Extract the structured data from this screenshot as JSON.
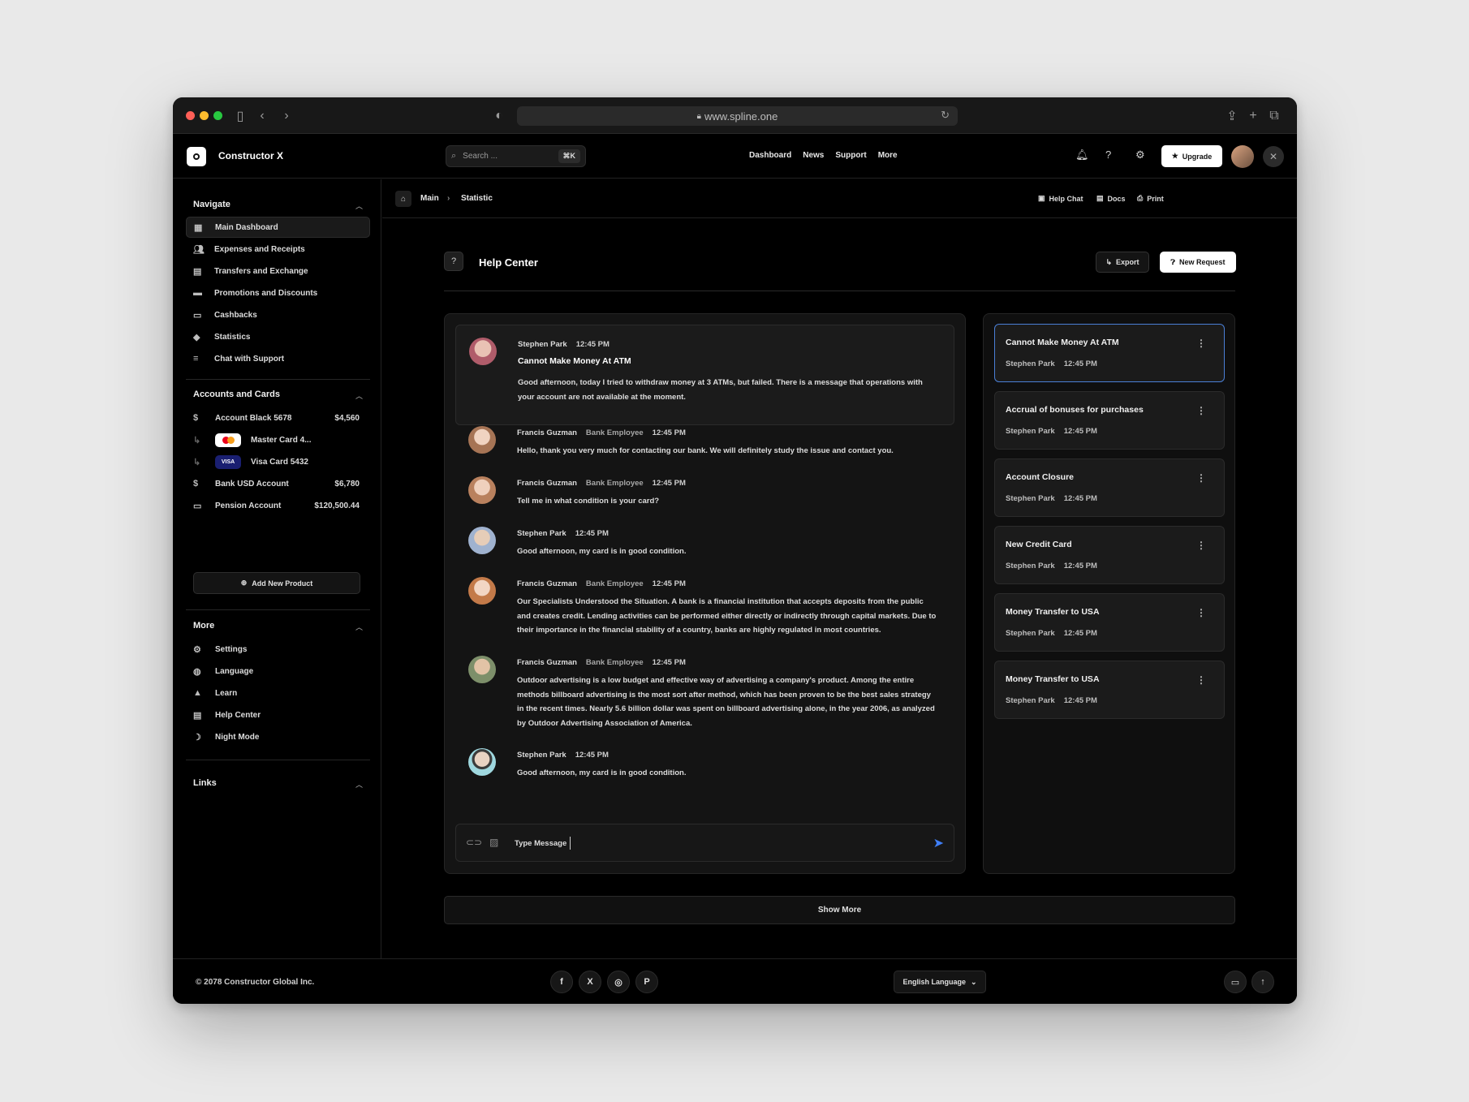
{
  "browser": {
    "url": "www.spline.one"
  },
  "app": {
    "name": "Constructor X"
  },
  "search": {
    "placeholder": "Search ...",
    "shortcut": "⌘K"
  },
  "topmenu": [
    "Dashboard",
    "News",
    "Support",
    "More"
  ],
  "upgrade_label": "Upgrade",
  "sidebar": {
    "navigate": {
      "title": "Navigate",
      "items": [
        {
          "label": "Main Dashboard",
          "icon": "dashboard-icon"
        },
        {
          "label": "Expenses and Receipts",
          "icon": "users-icon"
        },
        {
          "label": "Transfers and Exchange",
          "icon": "document-icon"
        },
        {
          "label": "Promotions and Discounts",
          "icon": "folder-icon"
        },
        {
          "label": "Cashbacks",
          "icon": "chat-icon"
        },
        {
          "label": "Statistics",
          "icon": "tag-icon"
        },
        {
          "label": "Chat with Support",
          "icon": "lines-icon"
        }
      ]
    },
    "accounts": {
      "title": "Accounts and Cards",
      "items": [
        {
          "label": "Account Black 5678",
          "amount": "$4,560"
        },
        {
          "label": "Master Card 4...",
          "amount": ""
        },
        {
          "label": "Visa Card 5432",
          "amount": "",
          "badge": "VISA"
        },
        {
          "label": "Bank USD Account",
          "amount": "$6,780"
        },
        {
          "label": "Pension Account",
          "amount": "$120,500.44"
        }
      ],
      "add_label": "Add New Product"
    },
    "more": {
      "title": "More",
      "items": [
        {
          "label": "Settings",
          "icon": "gear-icon"
        },
        {
          "label": "Language",
          "icon": "globe-icon"
        },
        {
          "label": "Learn",
          "icon": "graduation-cap-icon"
        },
        {
          "label": "Help Center",
          "icon": "document-icon"
        },
        {
          "label": "Night Mode",
          "icon": "moon-icon"
        }
      ]
    },
    "links": {
      "title": "Links"
    }
  },
  "breadcrumb": {
    "main": "Main",
    "current": "Statistic",
    "help_chat": "Help Chat",
    "docs": "Docs",
    "print": "Print"
  },
  "page": {
    "title": "Help Center",
    "export_label": "Export",
    "new_request_label": "New Request"
  },
  "first_message": {
    "author": "Stephen Park",
    "time": "12:45 PM",
    "subject": "Cannot Make Money At ATM",
    "body": "Good afternoon, today I tried to withdraw money at 3 ATMs, but failed. There is a message that operations with your account are not available at the moment."
  },
  "messages": [
    {
      "author": "Francis Guzman",
      "role": "Bank Employee",
      "time": "12:45 PM",
      "body": "Hello, thank you very much for contacting our bank. We will definitely study the issue and contact you."
    },
    {
      "author": "Francis Guzman",
      "role": "Bank Employee",
      "time": "12:45 PM",
      "body": "Tell me in what condition is your card?"
    },
    {
      "author": "Stephen Park",
      "role": "",
      "time": "12:45 PM",
      "body": "Good afternoon, my card is in good condition."
    },
    {
      "author": "Francis Guzman",
      "role": "Bank Employee",
      "time": "12:45 PM",
      "body": "Our Specialists Understood the Situation. A bank is a financial institution that accepts deposits from the public and creates credit. Lending activities can be performed either directly or indirectly through capital markets. Due to their importance in the financial stability of a country, banks are highly regulated in most countries."
    },
    {
      "author": "Francis Guzman",
      "role": "Bank Employee",
      "time": "12:45 PM",
      "body": "Outdoor advertising is a low budget and effective way of advertising a company's product. Among the entire methods billboard advertising is the most sort after method, which has been proven to be the best sales strategy in the recent times. Nearly 5.6 billion dollar was spent on billboard advertising alone, in the year 2006, as analyzed by Outdoor Advertising Association of America."
    },
    {
      "author": "Stephen Park",
      "role": "",
      "time": "12:45 PM",
      "body": "Good afternoon, my card is in good condition."
    }
  ],
  "composer": {
    "placeholder": "Type Message"
  },
  "threads": [
    {
      "title": "Cannot Make Money At ATM",
      "author": "Stephen Park",
      "time": "12:45 PM"
    },
    {
      "title": "Accrual of bonuses for purchases",
      "author": "Stephen Park",
      "time": "12:45 PM"
    },
    {
      "title": "Account Closure",
      "author": "Stephen Park",
      "time": "12:45 PM"
    },
    {
      "title": "New Credit Card",
      "author": "Stephen Park",
      "time": "12:45 PM"
    },
    {
      "title": "Money Transfer to USA",
      "author": "Stephen Park",
      "time": "12:45 PM"
    },
    {
      "title": "Money Transfer to USA",
      "author": "Stephen Park",
      "time": "12:45 PM"
    }
  ],
  "show_more_label": "Show More",
  "footer": {
    "copyright": "© 2078 Constructor Global Inc.",
    "language": "English Language",
    "social": [
      "f",
      "X",
      "◎",
      "P"
    ]
  },
  "colors": {
    "accent": "#3f7ef6",
    "selected_border": "#4a7fd6"
  }
}
